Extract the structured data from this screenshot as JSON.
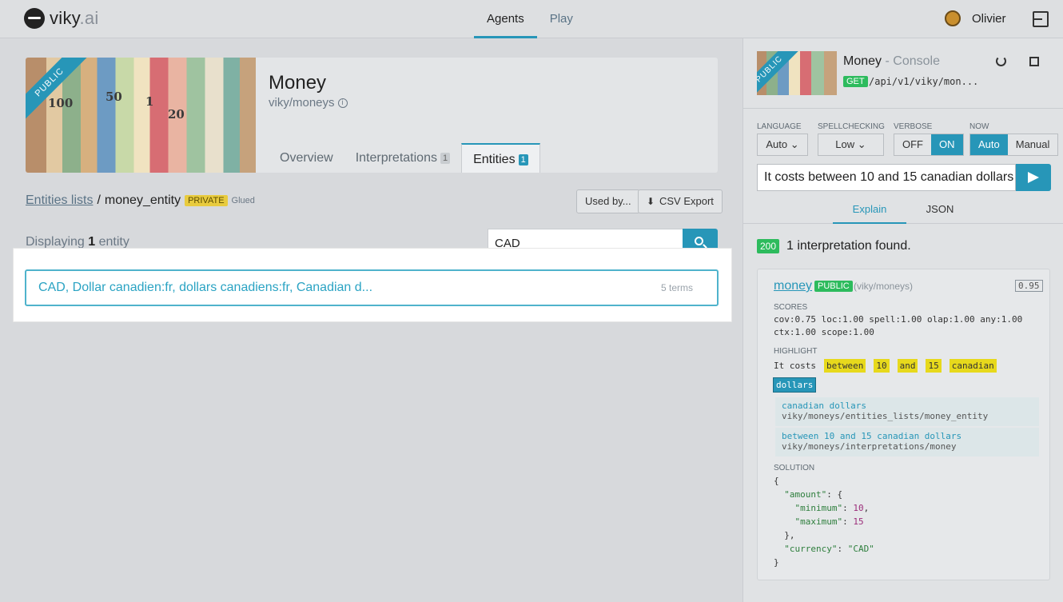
{
  "app": {
    "logo_main": "viky",
    "logo_suffix": ".ai"
  },
  "nav": {
    "items": [
      "Agents",
      "Play"
    ],
    "active": "Agents"
  },
  "user": {
    "name": "Olivier"
  },
  "agent": {
    "ribbon": "PUBLIC",
    "name": "Money",
    "slug": "viky/moneys",
    "image_numbers": [
      "100",
      "50",
      "1",
      "20"
    ],
    "tabs": [
      {
        "label": "Overview",
        "count": ""
      },
      {
        "label": "Interpretations",
        "count": "1"
      },
      {
        "label": "Entities",
        "count": "1"
      }
    ]
  },
  "breadcrumb": {
    "link": "Entities lists",
    "separator": "/",
    "current": "money_entity",
    "badge": "PRIVATE",
    "glued": "Glued"
  },
  "actions": {
    "used_by": "Used by...",
    "csv_export": "CSV Export"
  },
  "list": {
    "displaying_prefix": "Displaying",
    "count": "1",
    "displaying_suffix": "entity",
    "search_value": "CAD",
    "entity_text": "CAD, Dollar canadien:fr, dollars canadiens:fr, Canadian d...",
    "entity_terms": "5 terms"
  },
  "console": {
    "ribbon": "PUBLIC",
    "title": "Money",
    "title_suffix": "- Console",
    "method": "GET",
    "url": "/api/v1/viky/mon...",
    "options": {
      "language_label": "LANGUAGE",
      "language_value": "Auto",
      "spellchecking_label": "SPELLCHECKING",
      "spellchecking_value": "Low",
      "verbose_label": "VERBOSE",
      "verbose_off": "OFF",
      "verbose_on": "ON",
      "now_label": "NOW",
      "now_auto": "Auto",
      "now_manual": "Manual"
    },
    "query": "It costs between 10 and 15 canadian dollars",
    "tabs": [
      "Explain",
      "JSON"
    ],
    "status_code": "200",
    "found_text": "1 interpretation found.",
    "interpretation": {
      "name": "money",
      "badge": "PUBLIC",
      "slug": "(viky/moneys)",
      "score": "0.95",
      "scores_label": "SCORES",
      "scores_line1": "cov:0.75 loc:1.00 spell:1.00 olap:1.00 any:1.00",
      "scores_line2": "ctx:1.00 scope:1.00",
      "highlight_label": "HIGHLIGHT",
      "highlight_plain": "It costs",
      "highlight_words": [
        "between",
        "10",
        "and",
        "15",
        "canadian"
      ],
      "highlight_selected": "dollars",
      "match1_text": "canadian dollars",
      "match1_path": "viky/moneys/entities_lists/money_entity",
      "match2_text": "between 10 and 15 canadian dollars",
      "match2_path": "viky/moneys/interpretations/money",
      "solution_label": "SOLUTION",
      "solution": {
        "open": "{",
        "amount_key": "\"amount\"",
        "amount_open": ": {",
        "minimum_key": "\"minimum\"",
        "minimum_val": "10",
        "maximum_key": "\"maximum\"",
        "maximum_val": "15",
        "amount_close": "},",
        "currency_key": "\"currency\"",
        "currency_val": "\"CAD\"",
        "close": "}"
      }
    }
  },
  "colors": {
    "accent": "#2796b8",
    "success": "#2dbb5d",
    "warning": "#e8cb3e"
  }
}
